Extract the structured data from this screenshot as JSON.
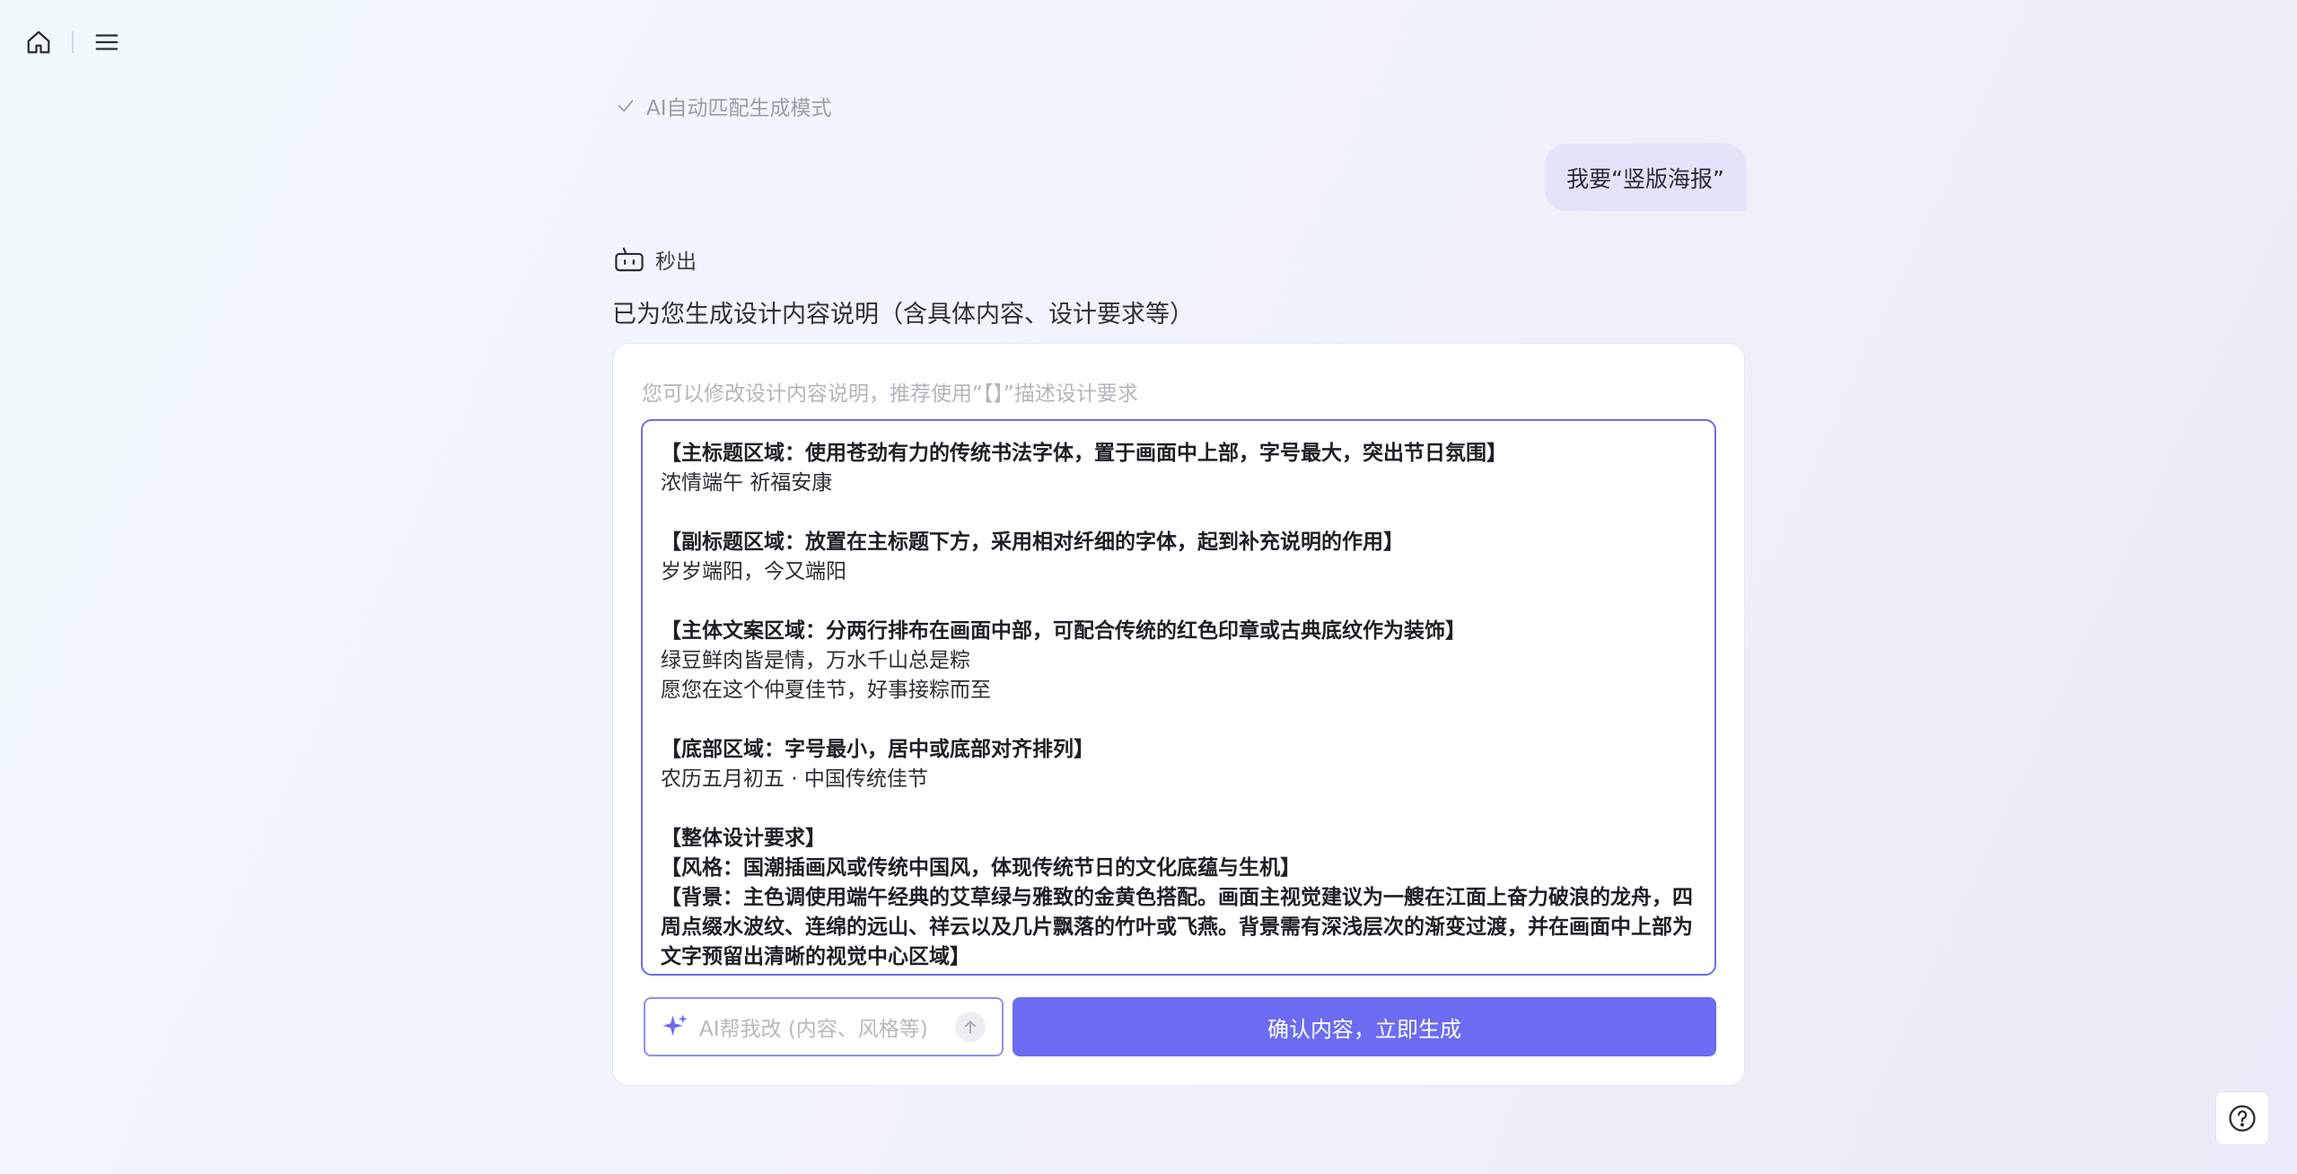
{
  "nav": {
    "home_icon": "home-icon",
    "menu_icon": "menu-icon"
  },
  "mode": {
    "label": "AI自动匹配生成模式"
  },
  "user_message": "我要“竖版海报”",
  "bot": {
    "label": "秒出",
    "message": "已为您生成设计内容说明（含具体内容、设计要求等）"
  },
  "card": {
    "hint": "您可以修改设计内容说明，推荐使用“【】”描述设计要求",
    "lines": [
      {
        "text": "【主标题区域：使用苍劲有力的传统书法字体，置于画面中上部，字号最大，突出节日氛围】",
        "bold": true
      },
      {
        "text": "浓情端午 祈福安康",
        "bold": false
      },
      {
        "text": "",
        "bold": false
      },
      {
        "text": "【副标题区域：放置在主标题下方，采用相对纤细的字体，起到补充说明的作用】",
        "bold": true
      },
      {
        "text": "岁岁端阳，今又端阳",
        "bold": false
      },
      {
        "text": "",
        "bold": false
      },
      {
        "text": "【主体文案区域：分两行排布在画面中部，可配合传统的红色印章或古典底纹作为装饰】",
        "bold": true
      },
      {
        "text": "绿豆鲜肉皆是情，万水千山总是粽",
        "bold": false
      },
      {
        "text": "愿您在这个仲夏佳节，好事接粽而至",
        "bold": false
      },
      {
        "text": "",
        "bold": false
      },
      {
        "text": "【底部区域：字号最小，居中或底部对齐排列】",
        "bold": true
      },
      {
        "text": "农历五月初五 · 中国传统佳节",
        "bold": false
      },
      {
        "text": "",
        "bold": false
      },
      {
        "text": "【整体设计要求】",
        "bold": true
      },
      {
        "text": "【风格：国潮插画风或传统中国风，体现传统节日的文化底蕴与生机】",
        "bold": true
      },
      {
        "text": "【背景：主色调使用端午经典的艾草绿与雅致的金黄色搭配。画面主视觉建议为一艘在江面上奋力破浪的龙舟，四",
        "bold": true
      },
      {
        "text": "周点缀水波纹、连绵的远山、祥云以及几片飘落的竹叶或飞燕。背景需有深浅层次的渐变过渡，并在画面中上部为",
        "bold": true
      },
      {
        "text": "文字预留出清晰的视觉中心区域】",
        "bold": true
      }
    ],
    "ai_placeholder": "AI帮我改 (内容、风格等)",
    "confirm_label": "确认内容，立即生成"
  },
  "colors": {
    "accent": "#6b6cf1",
    "bubble": "#e3e4fa"
  }
}
